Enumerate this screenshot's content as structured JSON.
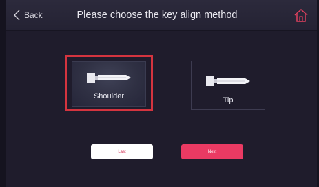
{
  "header": {
    "back_label": "Back",
    "title": "Please choose the key align method"
  },
  "options": {
    "shoulder_label": "Shoulder",
    "tip_label": "Tip",
    "selected": "Shoulder"
  },
  "buttons": {
    "last_label": "Last",
    "next_label": "Next"
  },
  "colors": {
    "selection_border": "#d4343f",
    "accent": "#ea3a63",
    "background": "#1f1c2c"
  }
}
